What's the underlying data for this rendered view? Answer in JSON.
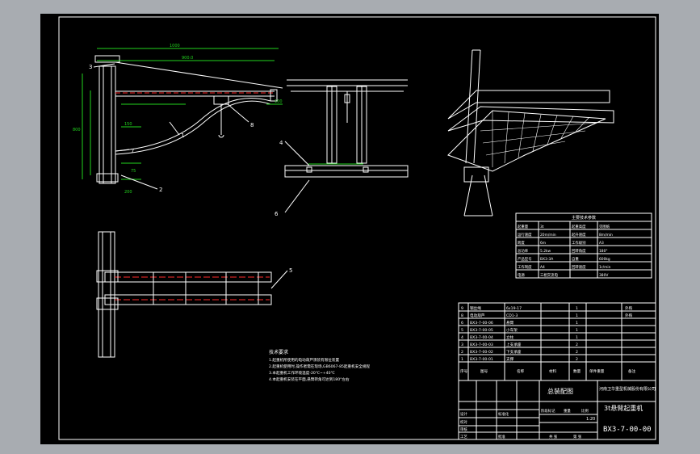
{
  "callouts": {
    "n1": "1",
    "n2": "2",
    "n3": "3",
    "n4": "4",
    "n5": "5",
    "n6": "6",
    "n7": "7",
    "n8": "8",
    "n9": "9"
  },
  "dims": {
    "d_top": "1000",
    "d_mid": "900.0",
    "d_small": "100",
    "d_h": "800",
    "d_150": "150",
    "d_200": "200",
    "d_75": "75"
  },
  "notes": {
    "title": "技术要求",
    "lines": [
      "1.起重机所使用的电动葫芦须装有限位装置",
      "2.起重机使用时,操作者需在现场,GB6067-85起重机安全规程",
      "3.本起重机工作环境温度-20℃~+40℃",
      "4.本起重机安装在平面,悬臂转角可达到180°左右"
    ]
  },
  "params": {
    "title": "主要技术参数",
    "rows": [
      [
        "起重量",
        "3t",
        "起重高度",
        "见图纸"
      ],
      [
        "运行速度",
        "20m/min",
        "起升速度",
        "8m/min"
      ],
      [
        "跨度",
        "6m",
        "工作级别",
        "A3"
      ],
      [
        "总功率",
        "5.2kw",
        "回转角度",
        "180°"
      ],
      [
        "产品型号",
        "BX3-3A",
        "自重",
        "600kg"
      ],
      [
        "工作制度",
        "A4",
        "回转速度",
        "1r/min"
      ],
      [
        "电源",
        "三相交流电",
        "",
        "380V"
      ]
    ]
  },
  "bom": {
    "rows": [
      [
        "9",
        "钢丝绳",
        "6x19-17",
        "",
        "",
        "1",
        "外购"
      ],
      [
        "8",
        "电动葫芦",
        "CD1-3",
        "",
        "",
        "1",
        "外购"
      ],
      [
        "6",
        "BX3-7-00-06",
        "悬臂",
        "",
        "",
        "1",
        ""
      ],
      [
        "5",
        "BX3-7-00-05",
        "小车架",
        "",
        "",
        "1",
        ""
      ],
      [
        "4",
        "BX3-7-00-04",
        "立柱",
        "",
        "",
        "1",
        ""
      ],
      [
        "3",
        "BX3-7-00-03",
        "上支承座",
        "",
        "",
        "2",
        ""
      ],
      [
        "2",
        "BX3-7-00-02",
        "下支承座",
        "",
        "",
        "2",
        ""
      ],
      [
        "1",
        "BX3-7-00-01",
        "支撑",
        "",
        "",
        "2",
        ""
      ]
    ],
    "header": [
      "序号",
      "图号",
      "名称",
      "材料",
      "数量",
      "单件重量",
      "备注"
    ]
  },
  "titleblock": {
    "assembly": "总装配图",
    "company": "河南卫华重型机械股份有限公司",
    "product": "3t悬臂起重机",
    "drawing_no": "BX3-7-00-00",
    "scale": "1:20",
    "labels": [
      "设计",
      "校对",
      "审核",
      "工艺",
      "标准化",
      "批准",
      "阶段标记",
      "重量",
      "比例",
      "共 张",
      "第 张"
    ]
  }
}
